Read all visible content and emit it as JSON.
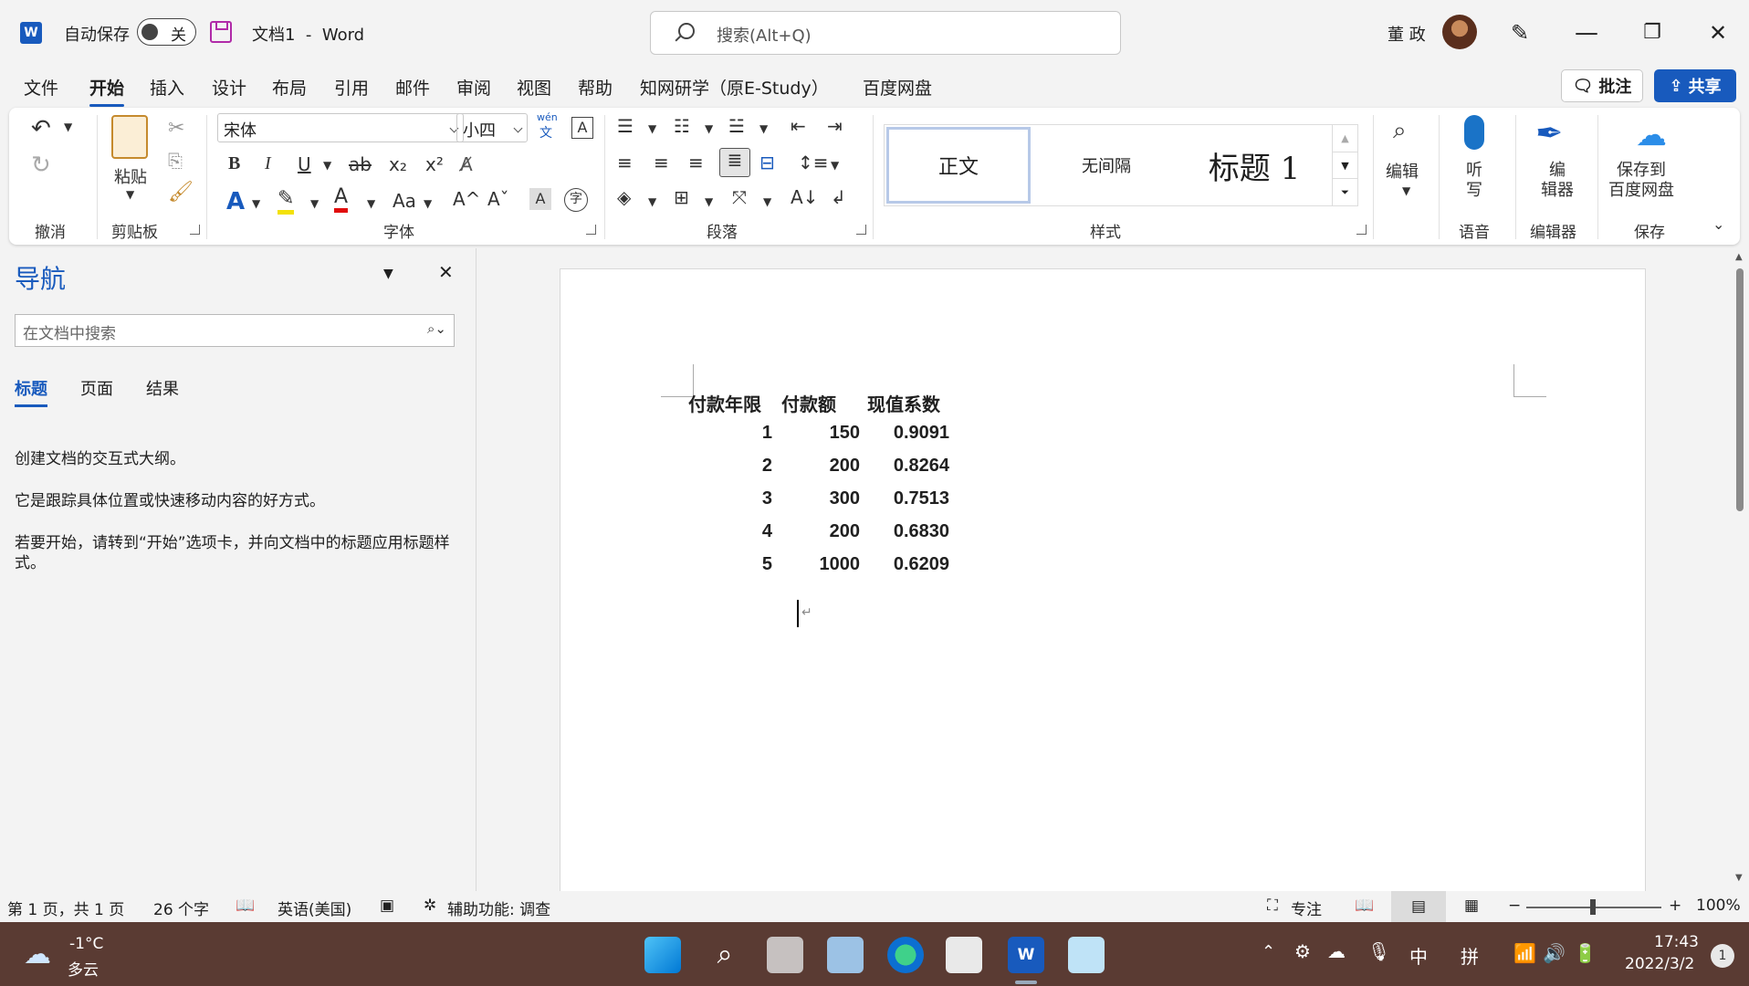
{
  "titlebar": {
    "app_icon_letter": "W",
    "autosave_label": "自动保存",
    "autosave_state": "关",
    "doc_title": "文档1  -  Word",
    "search_placeholder": "搜索(Alt+Q)",
    "user_name": "董 政",
    "controls": {
      "minimize": "—",
      "restore": "❐",
      "close": "✕"
    }
  },
  "menu": {
    "tabs": [
      "文件",
      "开始",
      "插入",
      "设计",
      "布局",
      "引用",
      "邮件",
      "审阅",
      "视图",
      "帮助",
      "知网研学（原E-Study）",
      "百度网盘"
    ],
    "active_tab": "开始",
    "comment_button": "批注",
    "share_button": "共享"
  },
  "ribbon": {
    "groups": {
      "undo": "撤消",
      "clipboard": "剪贴板",
      "font": "字体",
      "paragraph": "段落",
      "styles": "样式",
      "voice": "语音",
      "editor": "编辑器",
      "save": "保存"
    },
    "paste_label": "粘贴",
    "font_name": "宋体",
    "font_size": "小四",
    "phonetic_top": "wén",
    "phonetic_bottom": "文",
    "styles": [
      "正文",
      "无间隔",
      "标题 1"
    ],
    "edit_label": "编辑",
    "dictate_label": "听\n写",
    "editor_label": "编\n辑器",
    "baidu_save_label": "保存到\n百度网盘",
    "font_buttons": {
      "bold": "B",
      "italic": "I",
      "underline": "U",
      "strike": "ab",
      "subscript": "x₂",
      "superscript": "x²",
      "change_case": "Aa",
      "grow": "A^",
      "shrink": "Aˇ",
      "enclosed": "字",
      "shade": "A"
    }
  },
  "nav": {
    "title": "导航",
    "search_placeholder": "在文档中搜索",
    "tabs": [
      "标题",
      "页面",
      "结果"
    ],
    "active_tab": "标题",
    "help_lines": [
      "创建文档的交互式大纲。",
      "它是跟踪具体位置或快速移动内容的好方式。",
      "若要开始，请转到“开始”选项卡，并向文档中的标题应用标题样式。"
    ]
  },
  "document": {
    "headers": [
      "付款年限",
      "付款额",
      "现值系数"
    ],
    "rows": [
      [
        "1",
        "150",
        "0.9091"
      ],
      [
        "2",
        "200",
        "0.8264"
      ],
      [
        "3",
        "300",
        "0.7513"
      ],
      [
        "4",
        "200",
        "0.6830"
      ],
      [
        "5",
        "1000",
        "0.6209"
      ]
    ]
  },
  "statusbar": {
    "page_info": "第 1 页，共 1 页",
    "word_count": "26 个字",
    "language": "英语(美国)",
    "accessibility": "辅助功能: 调查",
    "focus": "专注",
    "zoom": "100%"
  },
  "taskbar": {
    "weather_temp": "-1°C",
    "weather_desc": "多云",
    "ime_lang": "中",
    "ime_mode": "拼",
    "time": "17:43",
    "date": "2022/3/2",
    "notification_count": "1"
  },
  "colors": {
    "accent": "#185abd",
    "taskbar": "#5a3b33",
    "save_icon": "#b02aa8"
  }
}
